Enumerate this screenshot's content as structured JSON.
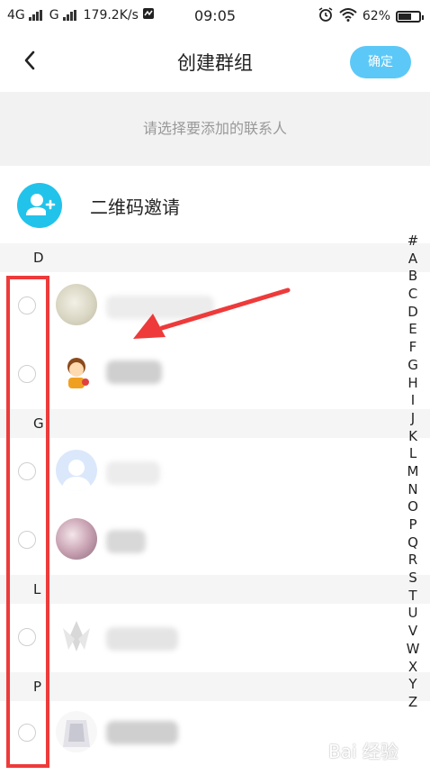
{
  "status_bar": {
    "network1": "4G",
    "network2": "G",
    "speed": "179.2K/s",
    "time": "09:05",
    "battery": "62%",
    "battery_level": 0.62
  },
  "header": {
    "title": "创建群组",
    "confirm_label": "确定"
  },
  "hint": "请选择要添加的联系人",
  "qr_invite": {
    "label": "二维码邀请",
    "icon": "add-user-icon"
  },
  "contacts": {
    "sections": [
      "D",
      "G",
      "L",
      "P"
    ]
  },
  "index_letters": [
    "#",
    "A",
    "B",
    "C",
    "D",
    "E",
    "F",
    "G",
    "H",
    "I",
    "J",
    "K",
    "L",
    "M",
    "N",
    "O",
    "P",
    "Q",
    "R",
    "S",
    "T",
    "U",
    "V",
    "W",
    "X",
    "Y",
    "Z"
  ],
  "watermark": "Bai 经验",
  "accent_colors": {
    "confirm": "#5cc8f7",
    "invite_icon": "#22c3ea",
    "highlight": "#ee3a3a"
  }
}
